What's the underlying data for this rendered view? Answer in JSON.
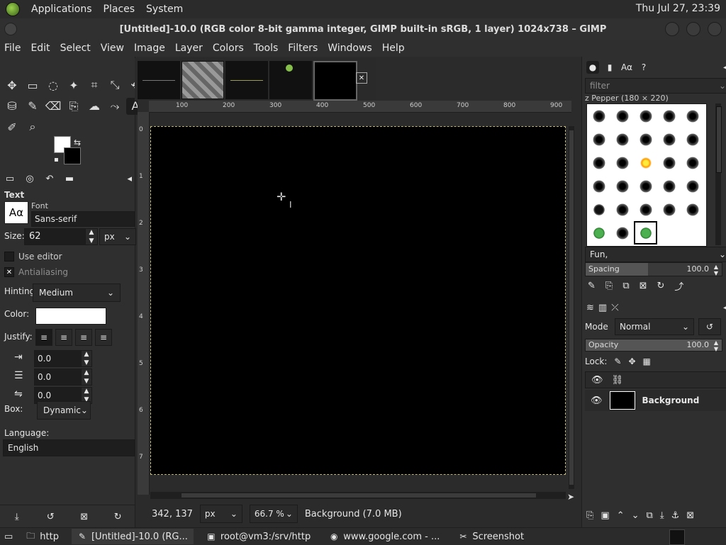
{
  "topbar": {
    "menus": [
      "Applications",
      "Places",
      "System"
    ],
    "clock": "Thu Jul 27, 23:39"
  },
  "titlebar": {
    "title": "[Untitled]-10.0 (RGB color 8-bit gamma integer, GIMP built-in sRGB, 1 layer) 1024x738 – GIMP"
  },
  "menubar": {
    "items": [
      "File",
      "Edit",
      "Select",
      "View",
      "Image",
      "Layer",
      "Colors",
      "Tools",
      "Filters",
      "Windows",
      "Help"
    ]
  },
  "toolbox": {
    "text_options": {
      "panel_title": "Text",
      "font_label": "Font",
      "font_preview": "Aα",
      "font_value": "Sans-serif",
      "size_label": "Size:",
      "size_value": "62",
      "size_unit": "px",
      "use_editor_label": "Use editor",
      "antialiasing_label": "Antialiasing",
      "hinting_label": "Hinting:",
      "hinting_value": "Medium",
      "color_label": "Color:",
      "color_value": "#ffffff",
      "justify_label": "Justify:",
      "indent_value": "0.0",
      "line_spacing_value": "0.0",
      "letter_spacing_value": "0.0",
      "box_label": "Box:",
      "box_value": "Dynamic",
      "language_label": "Language:",
      "language_value": "English"
    }
  },
  "canvas": {
    "ruler_ticks": [
      "100",
      "200",
      "300",
      "400",
      "500",
      "600",
      "700",
      "800",
      "900"
    ],
    "vertical_ruler_ticks": [
      "0",
      "1",
      "2",
      "3",
      "4",
      "5",
      "6",
      "7"
    ]
  },
  "status": {
    "coords": "342, 137",
    "unit": "px",
    "zoom": "66.7 %",
    "info": "Background (7.0 MB)"
  },
  "brushes": {
    "filter_placeholder": "filter",
    "brush_title": "z Pepper (180 × 220)",
    "fun_value": "Fun,",
    "spacing_label": "Spacing",
    "spacing_value": "100.0",
    "spacing_fraction": 0.46
  },
  "layers": {
    "mode_label": "Mode",
    "mode_value": "Normal",
    "opacity_label": "Opacity",
    "opacity_value": "100.0",
    "opacity_fraction": 1.0,
    "lock_label": "Lock:",
    "layer_name": "Background"
  },
  "taskbar": {
    "items": [
      {
        "label": "http"
      },
      {
        "label": "[Untitled]-10.0 (RG..."
      },
      {
        "label": "root@vm3:/srv/http"
      },
      {
        "label": "www.google.com - ..."
      },
      {
        "label": "Screenshot"
      }
    ]
  }
}
